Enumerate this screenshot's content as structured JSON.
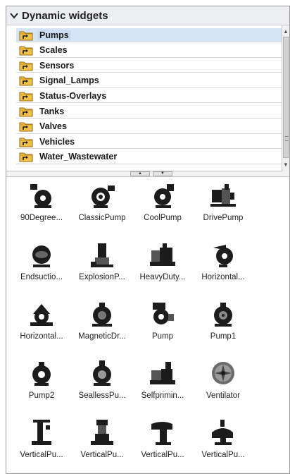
{
  "panel": {
    "title": "Dynamic widgets",
    "tree_items": [
      {
        "label": "Pumps",
        "selected": true
      },
      {
        "label": "Scales",
        "selected": false
      },
      {
        "label": "Sensors",
        "selected": false
      },
      {
        "label": "Signal_Lamps",
        "selected": false
      },
      {
        "label": "Status-Overlays",
        "selected": false
      },
      {
        "label": "Tanks",
        "selected": false
      },
      {
        "label": "Valves",
        "selected": false
      },
      {
        "label": "Vehicles",
        "selected": false
      },
      {
        "label": "Water_Wastewater",
        "selected": false
      }
    ]
  },
  "widgets": [
    {
      "label": "90Degree...",
      "icon": "pump-90degree-icon"
    },
    {
      "label": "ClassicPump",
      "icon": "classic-pump-icon"
    },
    {
      "label": "CoolPump",
      "icon": "cool-pump-icon"
    },
    {
      "label": "DrivePump",
      "icon": "drive-pump-icon"
    },
    {
      "label": "Endsuctio...",
      "icon": "endsuction-pump-icon"
    },
    {
      "label": "ExplosionP...",
      "icon": "explosion-pump-icon"
    },
    {
      "label": "HeavyDuty...",
      "icon": "heavy-duty-pump-icon"
    },
    {
      "label": "Horizontal...",
      "icon": "horizontal-pump-icon"
    },
    {
      "label": "Horizontal...",
      "icon": "horizontal-pump-2-icon"
    },
    {
      "label": "MagneticDr...",
      "icon": "magnetic-drive-pump-icon"
    },
    {
      "label": "Pump",
      "icon": "pump-icon"
    },
    {
      "label": "Pump1",
      "icon": "pump1-icon"
    },
    {
      "label": "Pump2",
      "icon": "pump2-icon"
    },
    {
      "label": "SeallessPu...",
      "icon": "sealless-pump-icon"
    },
    {
      "label": "Selfprimin...",
      "icon": "selfpriming-pump-icon"
    },
    {
      "label": "Ventilator",
      "icon": "ventilator-icon"
    },
    {
      "label": "VerticalPu...",
      "icon": "vertical-pump-1-icon"
    },
    {
      "label": "VerticalPu...",
      "icon": "vertical-pump-2-icon"
    },
    {
      "label": "VerticalPu...",
      "icon": "vertical-pump-3-icon"
    },
    {
      "label": "VerticalPu...",
      "icon": "vertical-pump-4-icon"
    }
  ]
}
